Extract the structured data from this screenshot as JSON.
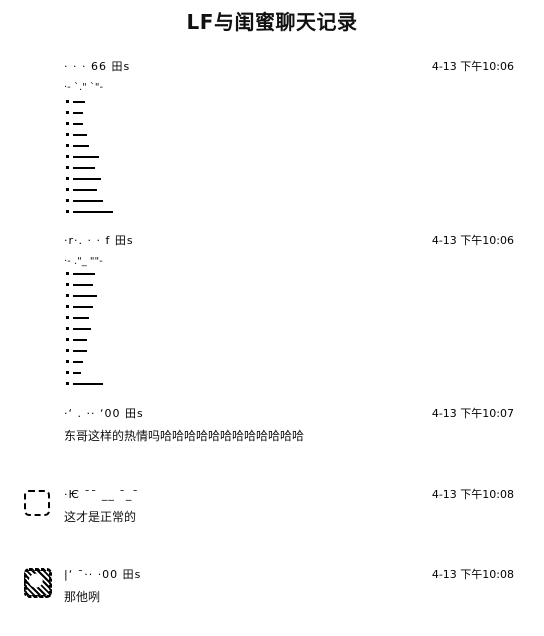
{
  "title": "LF与闺蜜聊天记录",
  "messages": [
    {
      "sender": "·  ·    ·   66 田s",
      "time": "4-13 下午10:06",
      "first_line": "·-   `.\" `\"-",
      "avatar": "none",
      "noise": [
        12,
        10,
        10,
        14,
        16,
        26,
        22,
        28,
        24,
        30,
        40
      ]
    },
    {
      "sender": "·r·. ·  ·  f 田s",
      "time": "4-13 下午10:06",
      "first_line": "·- .\"_ \"\"-",
      "avatar": "none",
      "noise": [
        22,
        20,
        24,
        20,
        16,
        18,
        14,
        14,
        10,
        8,
        30
      ]
    },
    {
      "sender": "·‘ .  ·· ‘00 田s",
      "time": "4-13 下午10:07",
      "text": "东哥这样的热情吗哈哈哈哈哈哈哈哈哈哈哈哈",
      "avatar": "none"
    },
    {
      "sender": "·Ѥ ˉˉ   __ ˉ_ˉ",
      "time": "4-13 下午10:08",
      "text": "这才是正常的",
      "avatar": "dashed"
    },
    {
      "sender": "|‘ ˉ·· ·00 田s",
      "time": "4-13 下午10:08",
      "text": "那他咧",
      "avatar": "solid"
    }
  ]
}
